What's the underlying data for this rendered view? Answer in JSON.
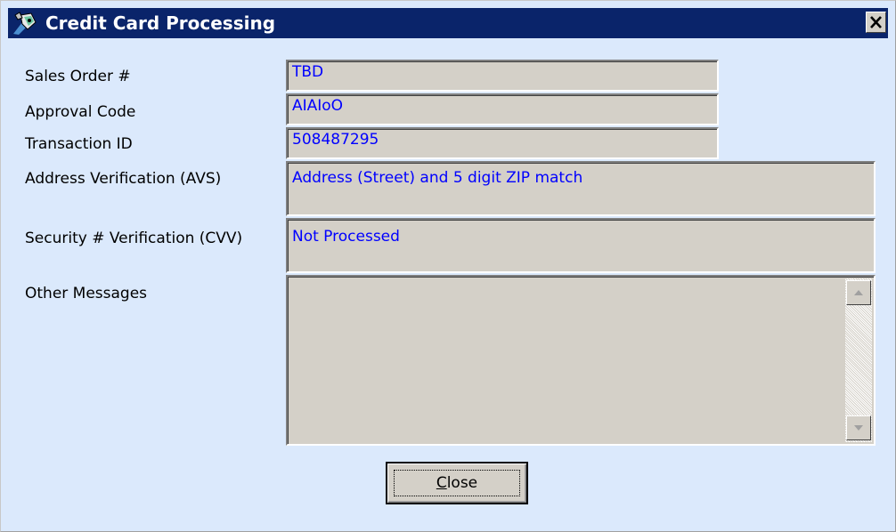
{
  "window": {
    "title": "Credit Card Processing",
    "icon": "credit-card-app-icon",
    "close_icon": "close-icon"
  },
  "fields": {
    "sales_order": {
      "label": "Sales Order #",
      "value": "TBD"
    },
    "approval_code": {
      "label": "Approval Code",
      "value": "AIAIoO"
    },
    "transaction_id": {
      "label": "Transaction ID",
      "value": "508487295"
    },
    "avs": {
      "label": "Address Verification (AVS)",
      "value": "Address (Street) and 5 digit ZIP match"
    },
    "cvv": {
      "label": "Security # Verification (CVV)",
      "value": "Not Processed"
    },
    "other_messages": {
      "label": "Other Messages",
      "value": ""
    }
  },
  "buttons": {
    "close_mnemonic": "C",
    "close_rest": "lose"
  },
  "colors": {
    "dialog_bg": "#dbe9fc",
    "titlebar": "#0a246a",
    "field_bg": "#d4d0c8",
    "value_text": "#0000ff"
  }
}
